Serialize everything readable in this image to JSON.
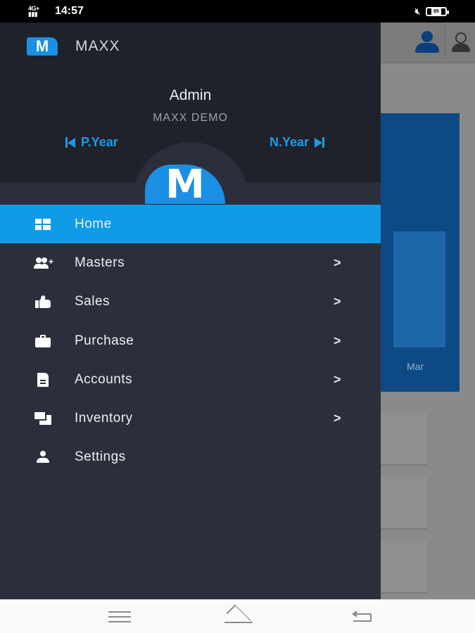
{
  "status_bar": {
    "network": "4G+",
    "time": "14:57",
    "battery": "85"
  },
  "background": {
    "chart_label": "Mar"
  },
  "drawer": {
    "brand_logo_letter": "M",
    "brand": "MAXX",
    "user_name": "Admin",
    "company": "MAXX DEMO",
    "prev_year": "P.Year",
    "next_year": "N.Year",
    "menu": [
      {
        "label": "Home",
        "icon": "dashboard-icon",
        "active": true,
        "has_submenu": false
      },
      {
        "label": "Masters",
        "icon": "group-add-icon",
        "active": false,
        "has_submenu": true
      },
      {
        "label": "Sales",
        "icon": "thumb-up-icon",
        "active": false,
        "has_submenu": true
      },
      {
        "label": "Purchase",
        "icon": "briefcase-icon",
        "active": false,
        "has_submenu": true
      },
      {
        "label": "Accounts",
        "icon": "document-icon",
        "active": false,
        "has_submenu": true
      },
      {
        "label": "Inventory",
        "icon": "forum-icon",
        "active": false,
        "has_submenu": true
      },
      {
        "label": "Settings",
        "icon": "person-icon",
        "active": false,
        "has_submenu": false
      }
    ],
    "chevron": ">"
  },
  "colors": {
    "accent": "#0f9be6",
    "drawer_bg": "#2b2f3b",
    "header_bg": "#1f222b",
    "link": "#1e9ae6"
  }
}
